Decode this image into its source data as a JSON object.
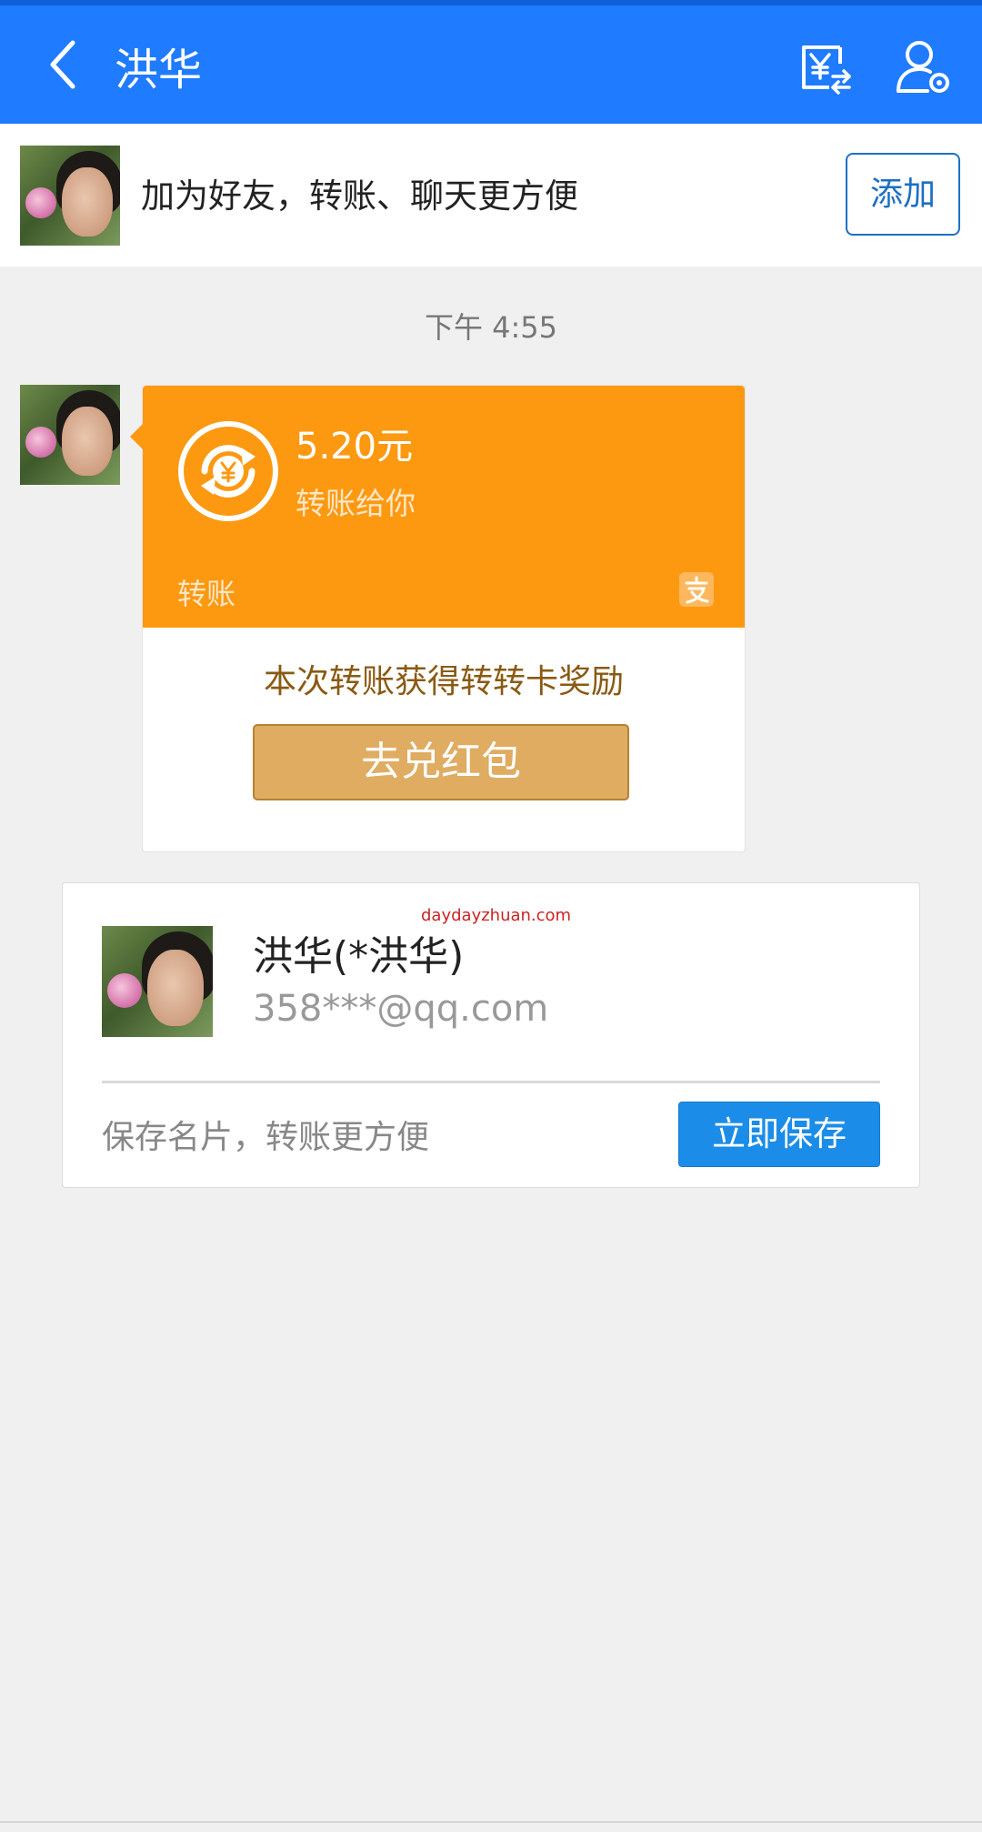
{
  "header": {
    "title": "洪华",
    "back_icon": "chevron-left-icon",
    "transfer_icon": "yuan-transfer-icon",
    "profile_icon": "user-settings-icon",
    "background_color": "#1f7bff"
  },
  "add_friend_banner": {
    "text": "加为好友，转账、聊天更方便",
    "button_label": "添加"
  },
  "chat": {
    "timestamp": "下午 4:55",
    "transfer_card": {
      "amount": "5.20元",
      "subtitle": "转账给你",
      "label": "转账",
      "reward_text": "本次转账获得转转卡奖励",
      "redeem_button": "去兑红包",
      "accent_color": "#fc9911"
    }
  },
  "contact_card": {
    "watermark": "daydayzhuan.com",
    "name": "洪华(*洪华)",
    "account": "358***@qq.com",
    "hint": "保存名片，转账更方便",
    "save_button": "立即保存",
    "button_color": "#1b8de8"
  }
}
